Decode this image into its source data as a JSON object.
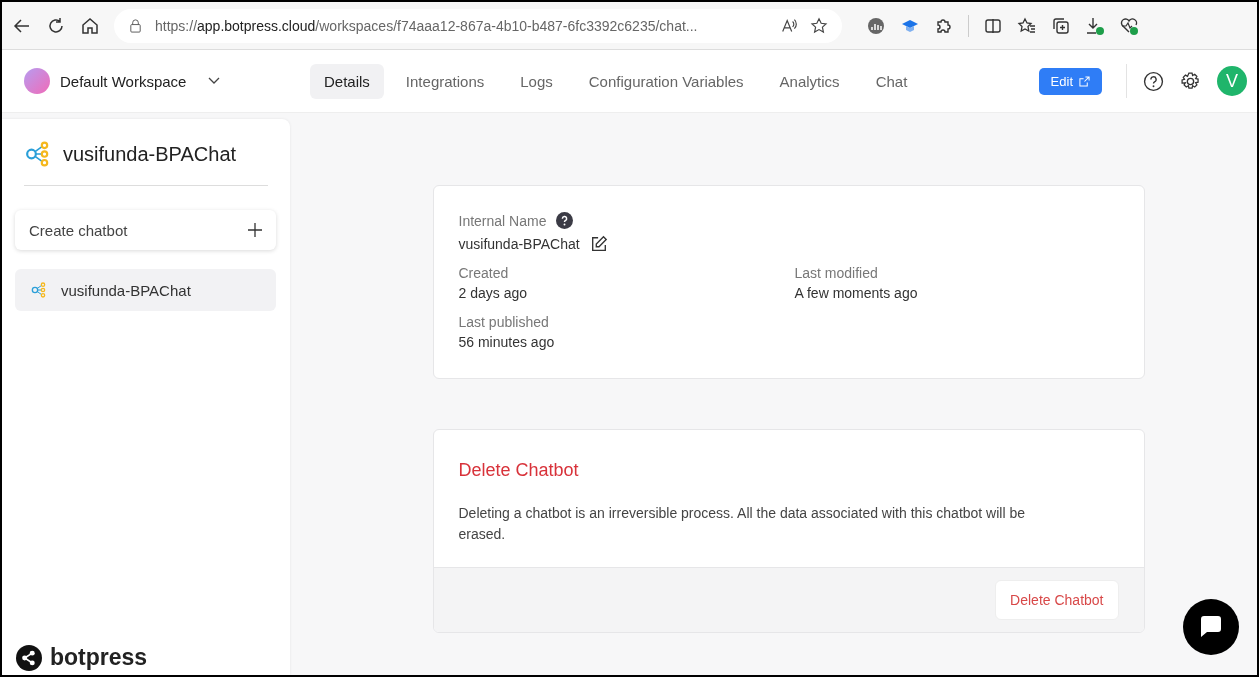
{
  "browser": {
    "url_host": "app.botpress.cloud",
    "url_path": "/workspaces/f74aaa12-867a-4b10-b487-6fc3392c6235/chat...",
    "url_scheme": "https://"
  },
  "header": {
    "workspace": "Default Workspace",
    "edit_button": "Edit",
    "avatar": "V"
  },
  "tabs": [
    {
      "label": "Details",
      "selected": true
    },
    {
      "label": "Integrations",
      "selected": false
    },
    {
      "label": "Logs",
      "selected": false
    },
    {
      "label": "Configuration Variables",
      "selected": false
    },
    {
      "label": "Analytics",
      "selected": false
    },
    {
      "label": "Chat",
      "selected": false
    }
  ],
  "sidebar": {
    "title": "vusifunda-BPAChat",
    "create_label": "Create chatbot",
    "items": [
      {
        "label": "vusifunda-BPAChat",
        "selected": true
      }
    ],
    "brand": "botpress"
  },
  "details": {
    "internal_name_label": "Internal Name",
    "internal_name": "vusifunda-BPAChat",
    "fields": [
      {
        "label": "Created",
        "value": "2 days ago"
      },
      {
        "label": "Last modified",
        "value": "A few moments ago"
      },
      {
        "label": "Last published",
        "value": "56 minutes ago"
      }
    ]
  },
  "danger": {
    "title": "Delete Chatbot",
    "text": "Deleting a chatbot is an irreversible process. All the data associated with this chatbot will be erased.",
    "button": "Delete Chatbot"
  }
}
